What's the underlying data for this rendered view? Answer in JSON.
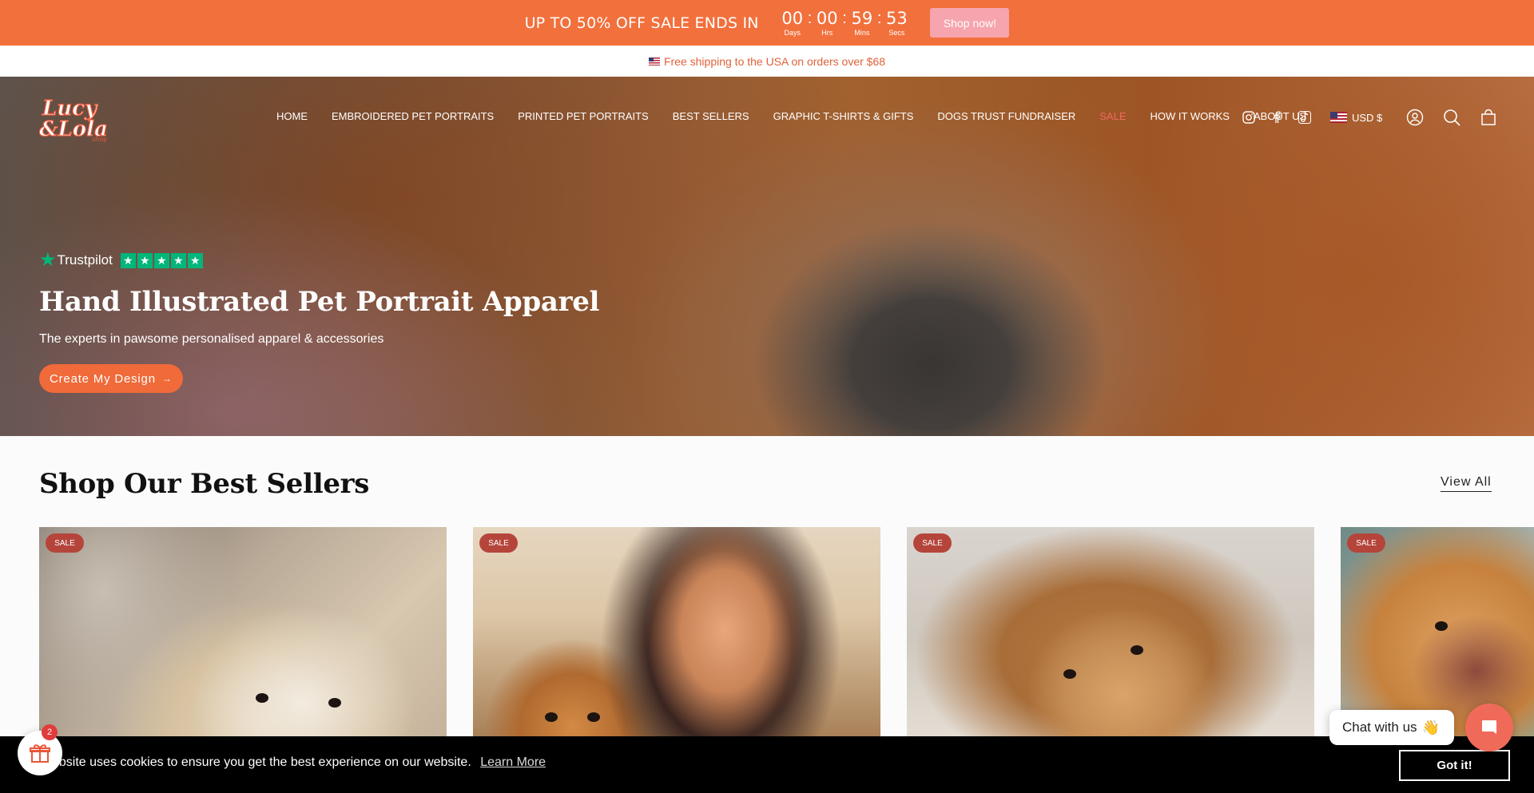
{
  "promo": {
    "text": "UP TO 50% OFF SALE ENDS IN",
    "countdown": [
      {
        "value": "00",
        "label": "Days"
      },
      {
        "value": "00",
        "label": "Hrs"
      },
      {
        "value": "59",
        "label": "Mins"
      },
      {
        "value": "53",
        "label": "Secs"
      }
    ],
    "separator": ":",
    "button": "Shop now!"
  },
  "shipping": {
    "text": "Free shipping to the USA on orders over $68"
  },
  "nav": {
    "items": [
      {
        "label": "HOME"
      },
      {
        "label": "EMBROIDERED PET PORTRAITS"
      },
      {
        "label": "PRINTED PET PORTRAITS"
      },
      {
        "label": "BEST SELLERS"
      },
      {
        "label": "GRAPHIC T-SHIRTS & GIFTS"
      },
      {
        "label": "DOGS TRUST FUNDRAISER"
      },
      {
        "label": "SALE"
      },
      {
        "label": "HOW IT WORKS"
      },
      {
        "label": "ABOUT US"
      }
    ],
    "social_icons": [
      "instagram-icon",
      "facebook-icon",
      "tiktok-icon"
    ],
    "currency": "USD $",
    "utility_icons": [
      "account-icon",
      "search-icon",
      "cart-icon"
    ]
  },
  "hero": {
    "trustpilot": "Trustpilot",
    "title": "Hand Illustrated Pet Portrait Apparel",
    "subtitle": "The experts in pawsome personalised apparel & accessories",
    "button": "Create My Design",
    "arrow": "→"
  },
  "best_sellers": {
    "title": "Shop Our Best Sellers",
    "view_all": "View All",
    "badge": "SALE"
  },
  "cookie": {
    "text": "ebsite uses cookies to ensure you get the best experience on our website.",
    "link": "Learn More",
    "button": "Got it!"
  },
  "gift": {
    "badge": "2"
  },
  "chat": {
    "label": "Chat with us",
    "wave": "👋"
  },
  "colors": {
    "accent": "#f2703c",
    "sale_nav": "#ef6a5e",
    "sale_badge": "#b5453b",
    "trustpilot_green": "#00b67a",
    "chat_button": "#f06a5a"
  }
}
